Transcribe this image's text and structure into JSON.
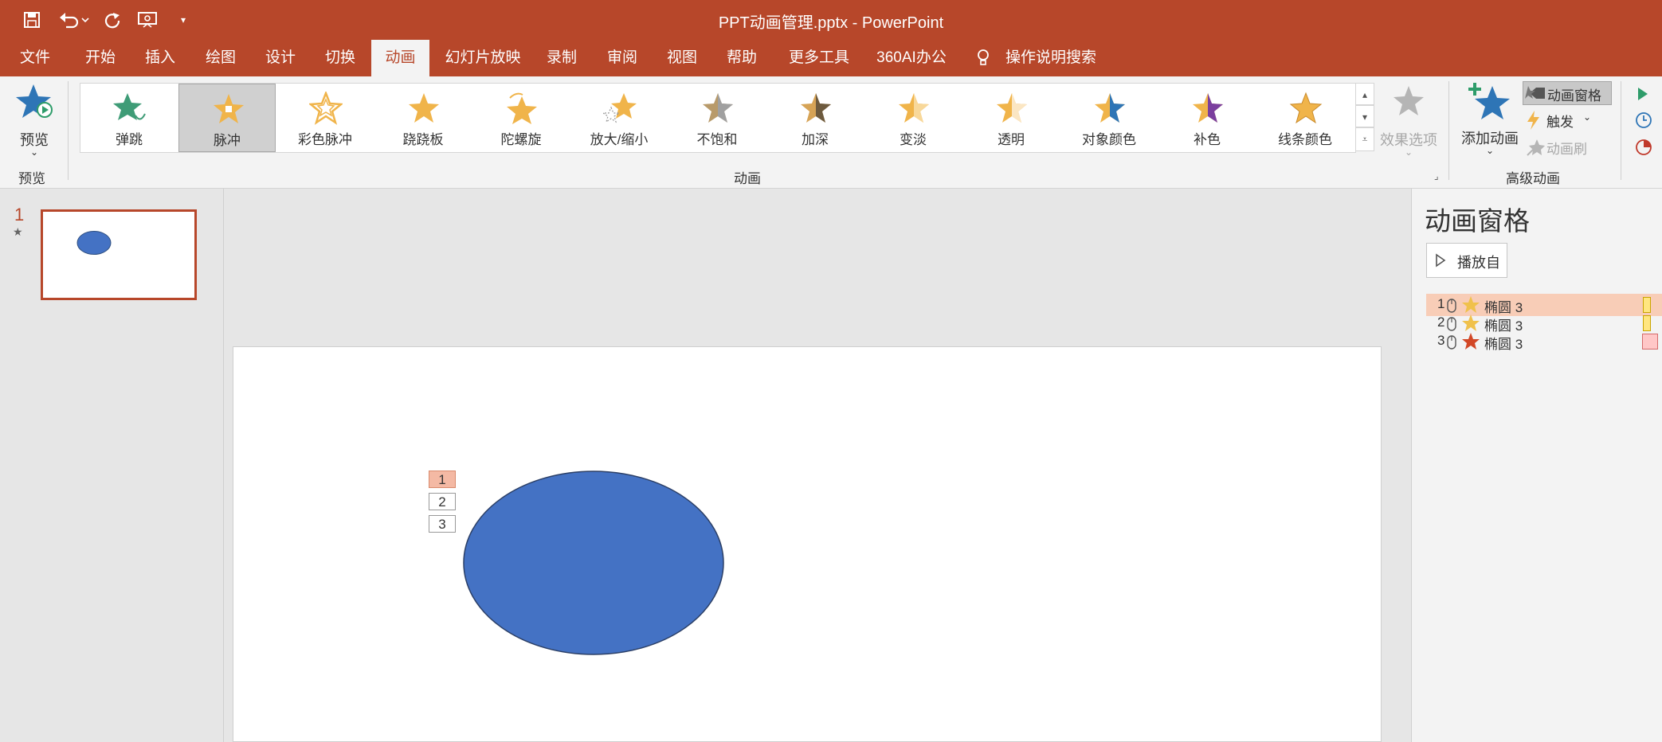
{
  "window": {
    "title": "PPT动画管理.pptx  -  PowerPoint"
  },
  "qat": {
    "save_icon": "save-icon",
    "undo_icon": "undo-icon",
    "redo_icon": "redo-icon",
    "present_icon": "present-from-beginning-icon",
    "customize_icon": "customize-qat-icon"
  },
  "tabs": [
    "文件",
    "开始",
    "插入",
    "绘图",
    "设计",
    "切换",
    "动画",
    "幻灯片放映",
    "录制",
    "审阅",
    "视图",
    "帮助",
    "更多工具",
    "360AI办公",
    "操作说明搜索"
  ],
  "active_tab": "动画",
  "ribbon": {
    "preview": {
      "label": "预览",
      "group": "预览"
    },
    "animations": {
      "group": "动画",
      "items": [
        "弹跳",
        "脉冲",
        "彩色脉冲",
        "跷跷板",
        "陀螺旋",
        "放大/缩小",
        "不饱和",
        "加深",
        "变淡",
        "透明",
        "对象颜色",
        "补色",
        "线条颜色"
      ],
      "selected": "脉冲",
      "effect_options": "效果选项"
    },
    "advanced": {
      "group": "高级动画",
      "add_animation": "添加动画",
      "animation_pane": "动画窗格",
      "trigger": "触发",
      "animation_painter": "动画刷"
    }
  },
  "slides": {
    "number": "1"
  },
  "slide": {
    "order_tags": [
      "1",
      "2",
      "3"
    ]
  },
  "anim_pane": {
    "title": "动画窗格",
    "play_from": "播放自",
    "items": [
      {
        "num": "1",
        "name": "椭圆 3",
        "effect": "emphasis",
        "color": "#f0c14b",
        "bar_color": "#ffe680",
        "selected": true
      },
      {
        "num": "2",
        "name": "椭圆 3",
        "effect": "emphasis",
        "color": "#f0c14b",
        "bar_color": "#ffe680",
        "selected": false
      },
      {
        "num": "3",
        "name": "椭圆 3",
        "effect": "emphasis",
        "color": "#d24726",
        "bar_color": "#ffc7c7",
        "selected": false
      }
    ]
  },
  "colors": {
    "accent": "#b7472a",
    "shape_fill": "#4472c4"
  }
}
